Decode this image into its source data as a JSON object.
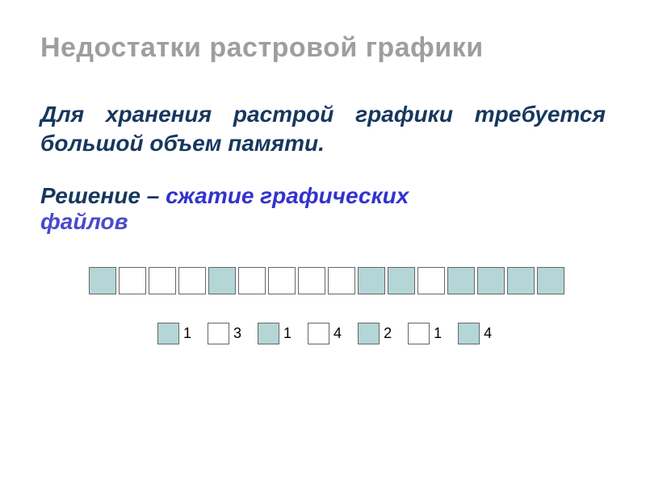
{
  "title": "Недостатки растровой графики",
  "body_text": "Для хранения растрой графики требуется большой объем памяти.",
  "solution": {
    "prefix": "Решение – ",
    "highlight1": "сжатие графических",
    "highlight2": "файлов"
  },
  "pixel_pattern": [
    true,
    false,
    false,
    false,
    true,
    false,
    false,
    false,
    false,
    true,
    true,
    false,
    true,
    true,
    true,
    true
  ],
  "rle": [
    {
      "filled": true,
      "count": "1"
    },
    {
      "filled": false,
      "count": "3"
    },
    {
      "filled": true,
      "count": "1"
    },
    {
      "filled": false,
      "count": "4"
    },
    {
      "filled": true,
      "count": "2"
    },
    {
      "filled": false,
      "count": "1"
    },
    {
      "filled": true,
      "count": "4"
    }
  ]
}
